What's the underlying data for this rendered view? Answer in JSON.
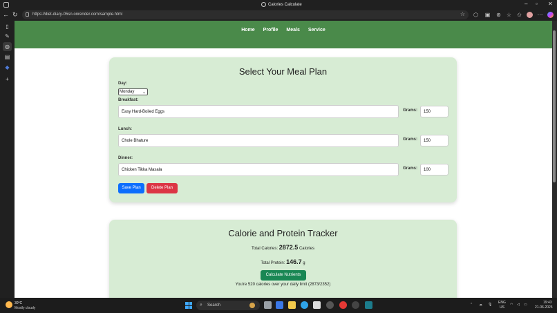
{
  "browser": {
    "tab_title": "Calories Calculate",
    "url": "https://diet-diary-05sn.onrender.com/sample.html"
  },
  "nav": {
    "links": [
      "Home",
      "Profile",
      "Meals",
      "Service"
    ]
  },
  "meal_plan": {
    "title": "Select Your Meal Plan",
    "day_label": "Day:",
    "day_value": "Monday",
    "breakfast_label": "Breakfast:",
    "breakfast_value": "Easy Hard-Boiled Eggs",
    "breakfast_grams": "150",
    "lunch_label": "Lunch:",
    "lunch_value": "Chole Bhature",
    "lunch_grams": "150",
    "dinner_label": "Dinner:",
    "dinner_value": "Chicken Tikka Masala",
    "dinner_grams": "100",
    "grams_label": "Grams:",
    "save_label": "Save Plan",
    "delete_label": "Delete Plan"
  },
  "tracker": {
    "title": "Calorie and Protein Tracker",
    "calories_prefix": "Total Calories:",
    "calories_value": "2872.5",
    "calories_suffix": "Calories",
    "protein_prefix": "Total Protein:",
    "protein_value": "146.7",
    "protein_suffix": "g",
    "calculate_label": "Calculate Nutrients",
    "over_message": "You're 520 calories over your daily limit (2873/2352)"
  },
  "taskbar": {
    "weather_temp": "30°C",
    "weather_desc": "Mostly cloudy",
    "search_label": "Search",
    "lang_top": "ENG",
    "lang_bottom": "US",
    "time": "19:43",
    "date": "21-06-2025"
  },
  "colors": {
    "nav_green": "#4a8a4a",
    "card_bg": "#d7ecd4",
    "save_blue": "#0d6efd",
    "delete_red": "#dc3545",
    "calc_green": "#198754"
  }
}
